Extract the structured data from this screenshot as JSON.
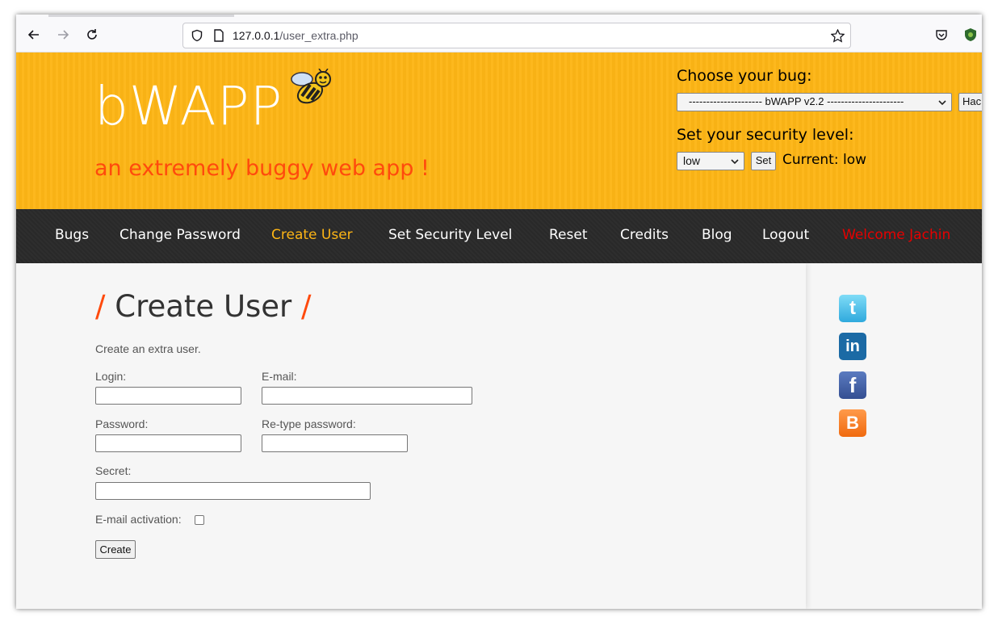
{
  "browser": {
    "url_host": "127.0.0.1",
    "url_path": "/user_extra.php"
  },
  "header": {
    "logo": "bWAPP",
    "tagline": "an extremely buggy web app !",
    "bug_label": "Choose your bug:",
    "bug_selected": "--------------------- bWAPP v2.2 ----------------------",
    "hack_button": "Hack",
    "security_label": "Set your security level:",
    "security_selected": "low",
    "set_button": "Set",
    "current_label": "Current:",
    "current_value": "low"
  },
  "menu": {
    "items": [
      "Bugs",
      "Change Password",
      "Create User",
      "Set Security Level",
      "Reset",
      "Credits",
      "Blog",
      "Logout"
    ],
    "welcome": "Welcome Jachin",
    "active_color": "#fdb515",
    "welcome_color": "#e60000"
  },
  "form": {
    "title": "Create User",
    "intro": "Create an extra user.",
    "login_label": "Login:",
    "email_label": "E-mail:",
    "password_label": "Password:",
    "retype_label": "Re-type password:",
    "secret_label": "Secret:",
    "activation_label": "E-mail activation:",
    "create_button": "Create"
  },
  "social": {
    "twitter": "t",
    "linkedin": "in",
    "facebook": "f",
    "blogger": "B"
  },
  "colors": {
    "header_bg": "#fdb515",
    "accent": "#ff4a0d",
    "menu_bg": "#2a2a2a"
  }
}
